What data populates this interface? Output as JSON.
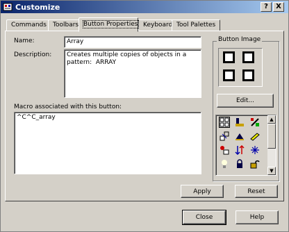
{
  "window": {
    "title": "Customize",
    "help_button": "?",
    "close_button": "X"
  },
  "tabs": [
    {
      "label": "Commands"
    },
    {
      "label": "Toolbars"
    },
    {
      "label": "Button Properties"
    },
    {
      "label": "Keyboard"
    },
    {
      "label": "Tool Palettes"
    }
  ],
  "button_properties": {
    "name_label": "Name:",
    "name_value": "Array",
    "description_label": "Description:",
    "description_value": "Creates multiple copies of objects in a pattern:  ARRAY",
    "macro_label": "Macro associated with this button:",
    "macro_value": "^C^C_array"
  },
  "button_image": {
    "group_label": "Button Image",
    "edit_label": "Edit...",
    "icons": [
      "array-icon",
      "layer-icon",
      "edit-icon",
      "scale-icon",
      "triangle-icon",
      "pencil-icon",
      "node-icon",
      "sort-icon",
      "snowflake-icon",
      "group-icon",
      "arrow-icon",
      "swap-icon",
      "bulb-icon",
      "lock-icon",
      "unlock-icon"
    ]
  },
  "buttons": {
    "apply": "Apply",
    "reset": "Reset",
    "close": "Close",
    "help": "Help"
  },
  "colors": {
    "titlebar_start": "#0a246a",
    "titlebar_end": "#a6caf0",
    "face": "#d4d0c8"
  }
}
